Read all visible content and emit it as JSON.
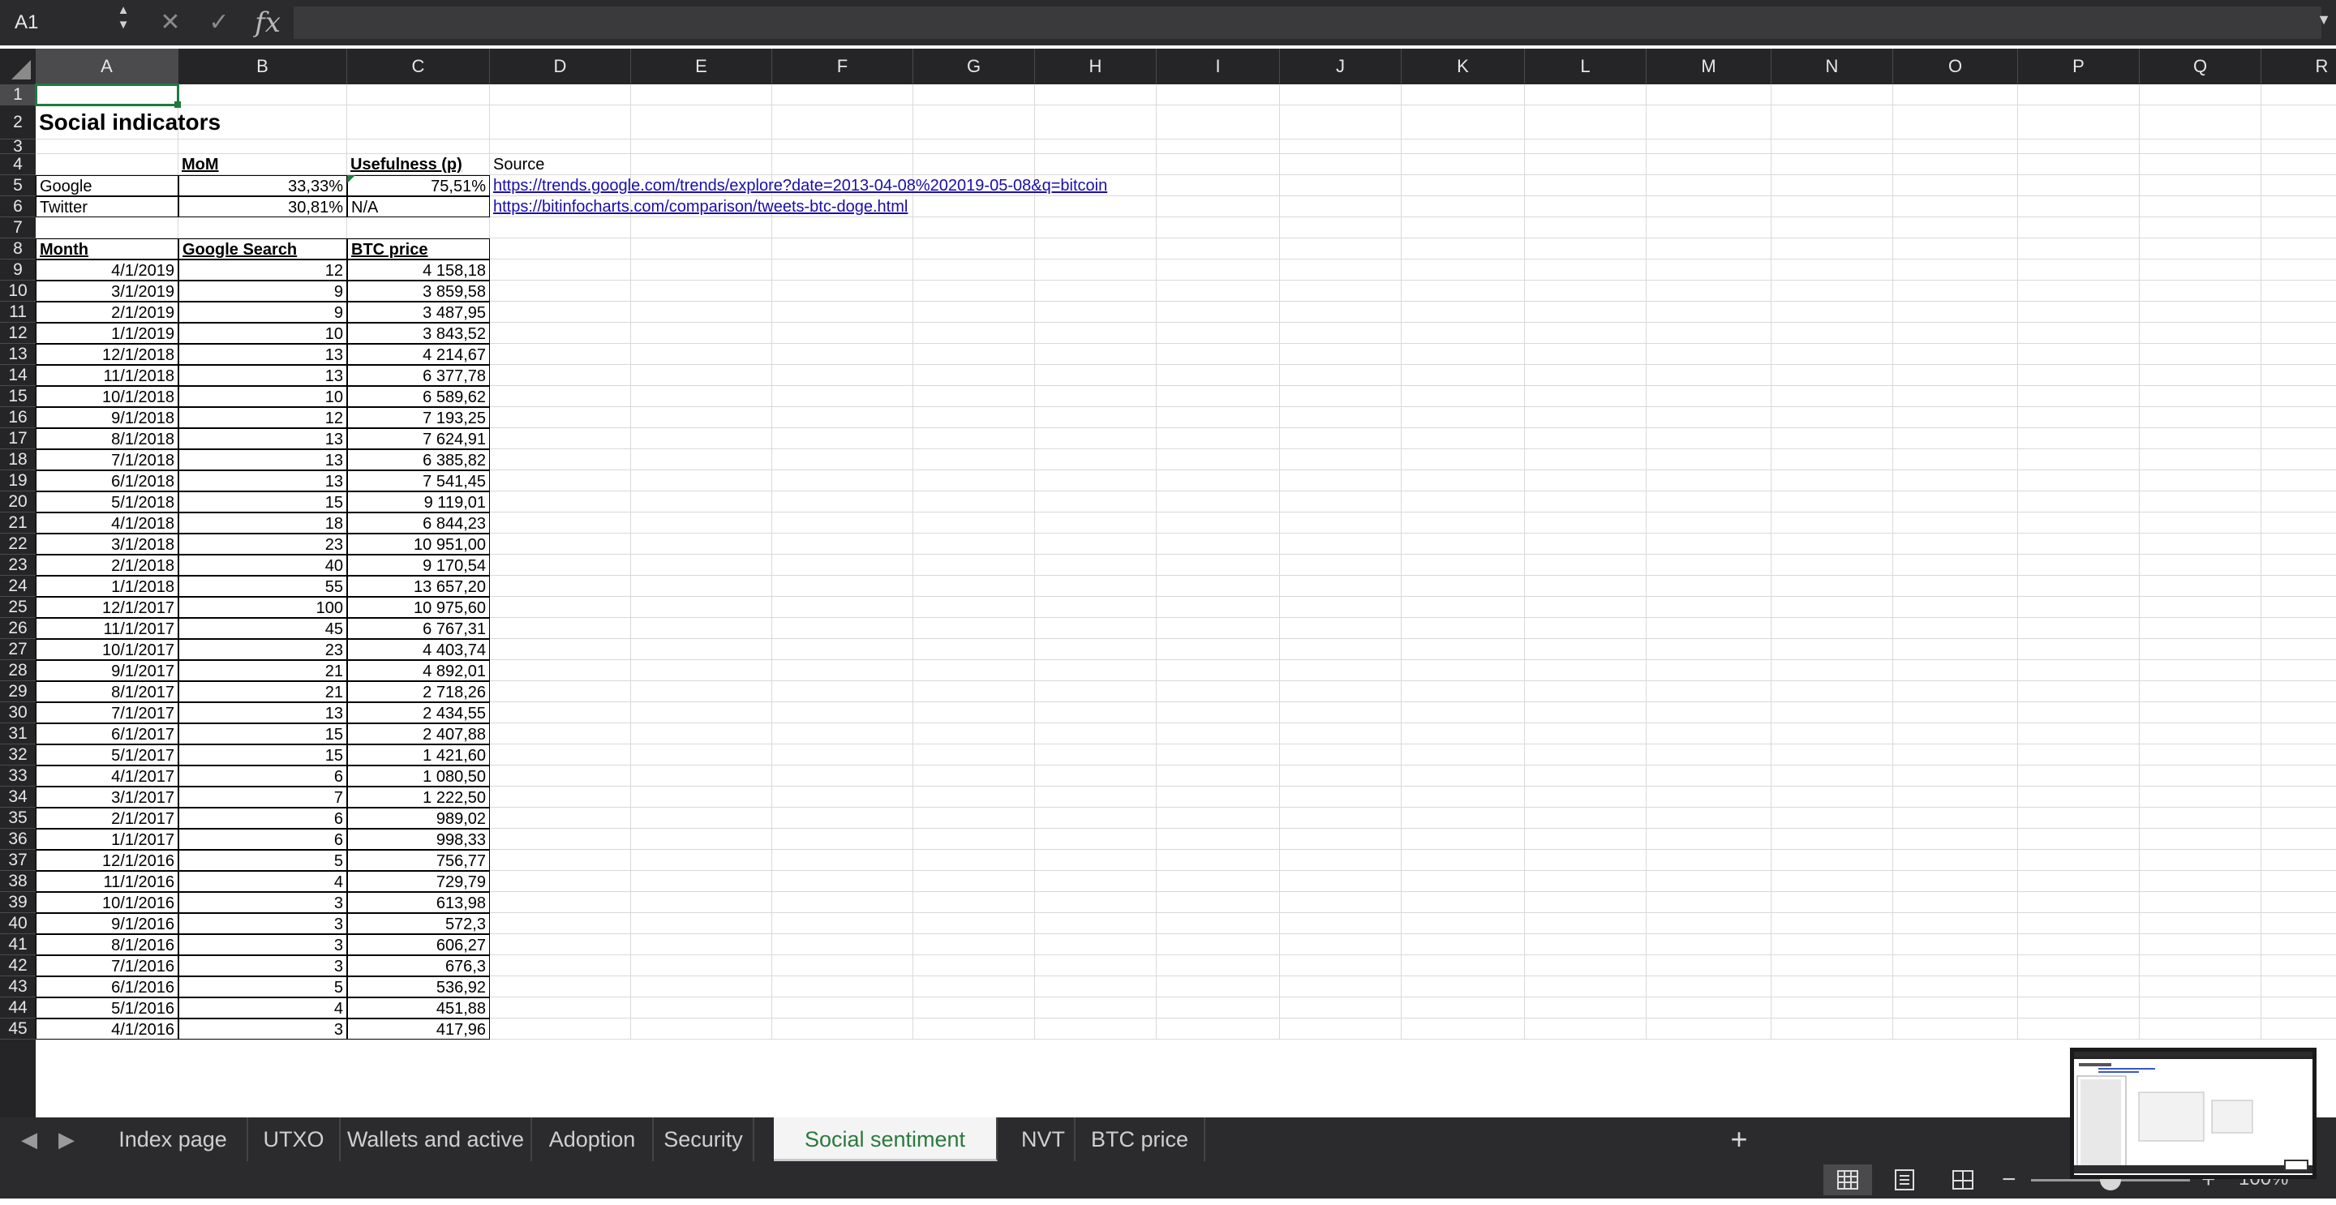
{
  "formula_bar": {
    "name_box": "A1",
    "cancel_icon": "✕",
    "enter_icon": "✓",
    "fx_label": "fx",
    "formula": ""
  },
  "columns": [
    "A",
    "B",
    "C",
    "D",
    "E",
    "F",
    "G",
    "H",
    "I",
    "J",
    "K",
    "L",
    "M",
    "N",
    "O",
    "P",
    "Q",
    "R"
  ],
  "rows": [
    "1",
    "2",
    "3",
    "4",
    "5",
    "6",
    "7",
    "8",
    "9",
    "10",
    "11",
    "12",
    "13",
    "14",
    "15",
    "16",
    "17",
    "18",
    "19",
    "20",
    "21",
    "22",
    "23",
    "24",
    "25",
    "26",
    "27",
    "28",
    "29",
    "30",
    "31",
    "32",
    "33",
    "34",
    "35",
    "36",
    "37",
    "38",
    "39",
    "40",
    "41",
    "42",
    "43",
    "44",
    "45"
  ],
  "sheet": {
    "title": "Social indicators",
    "summary_headers": {
      "mom": "MoM",
      "usefulness": "Usefulness (p)",
      "source": "Source"
    },
    "summary_rows": [
      {
        "name": "Google",
        "mom": "33,33%",
        "usefulness": "75,51%",
        "source": "https://trends.google.com/trends/explore?date=2013-04-08%202019-05-08&q=bitcoin"
      },
      {
        "name": "Twitter",
        "mom": "30,81%",
        "usefulness": "N/A",
        "source": "https://bitinfocharts.com/comparison/tweets-btc-doge.html"
      }
    ],
    "table_headers": {
      "month": "Month",
      "google_search": "Google Search",
      "btc_price": "BTC price"
    },
    "table_rows": [
      [
        "4/1/2019",
        "12",
        "4 158,18"
      ],
      [
        "3/1/2019",
        "9",
        "3 859,58"
      ],
      [
        "2/1/2019",
        "9",
        "3 487,95"
      ],
      [
        "1/1/2019",
        "10",
        "3 843,52"
      ],
      [
        "12/1/2018",
        "13",
        "4 214,67"
      ],
      [
        "11/1/2018",
        "13",
        "6 377,78"
      ],
      [
        "10/1/2018",
        "10",
        "6 589,62"
      ],
      [
        "9/1/2018",
        "12",
        "7 193,25"
      ],
      [
        "8/1/2018",
        "13",
        "7 624,91"
      ],
      [
        "7/1/2018",
        "13",
        "6 385,82"
      ],
      [
        "6/1/2018",
        "13",
        "7 541,45"
      ],
      [
        "5/1/2018",
        "15",
        "9 119,01"
      ],
      [
        "4/1/2018",
        "18",
        "6 844,23"
      ],
      [
        "3/1/2018",
        "23",
        "10 951,00"
      ],
      [
        "2/1/2018",
        "40",
        "9 170,54"
      ],
      [
        "1/1/2018",
        "55",
        "13 657,20"
      ],
      [
        "12/1/2017",
        "100",
        "10 975,60"
      ],
      [
        "11/1/2017",
        "45",
        "6 767,31"
      ],
      [
        "10/1/2017",
        "23",
        "4 403,74"
      ],
      [
        "9/1/2017",
        "21",
        "4 892,01"
      ],
      [
        "8/1/2017",
        "21",
        "2 718,26"
      ],
      [
        "7/1/2017",
        "13",
        "2 434,55"
      ],
      [
        "6/1/2017",
        "15",
        "2 407,88"
      ],
      [
        "5/1/2017",
        "15",
        "1 421,60"
      ],
      [
        "4/1/2017",
        "6",
        "1 080,50"
      ],
      [
        "3/1/2017",
        "7",
        "1 222,50"
      ],
      [
        "2/1/2017",
        "6",
        "989,02"
      ],
      [
        "1/1/2017",
        "6",
        "998,33"
      ],
      [
        "12/1/2016",
        "5",
        "756,77"
      ],
      [
        "11/1/2016",
        "4",
        "729,79"
      ],
      [
        "10/1/2016",
        "3",
        "613,98"
      ],
      [
        "9/1/2016",
        "3",
        "572,3"
      ],
      [
        "8/1/2016",
        "3",
        "606,27"
      ],
      [
        "7/1/2016",
        "3",
        "676,3"
      ],
      [
        "6/1/2016",
        "5",
        "536,92"
      ],
      [
        "5/1/2016",
        "4",
        "451,88"
      ],
      [
        "4/1/2016",
        "3",
        "417,96"
      ]
    ]
  },
  "tabs": [
    {
      "label": "Index page"
    },
    {
      "label": "UTXO"
    },
    {
      "label": "Wallets and active addresses"
    },
    {
      "label": "Adoption metrics"
    },
    {
      "label": "Security metrics"
    },
    {
      "label": "Social sentiment analysis",
      "active": true
    },
    {
      "label": "NVT"
    },
    {
      "label": "BTC price"
    }
  ],
  "add_tab_label": "+",
  "status": {
    "zoom_minus": "−",
    "zoom_plus": "+",
    "zoom_level": "100%",
    "zoom_fraction": 0.5
  },
  "colors": {
    "accent": "#1e7a3e",
    "link": "#1a0dab",
    "chrome": "#2b2b2d"
  },
  "icons": [
    "name-box-stepper-icon",
    "cancel-icon",
    "enter-icon",
    "function-icon",
    "formula-dropdown-icon",
    "select-all-corner-icon",
    "scroll-tabs-left-icon",
    "scroll-tabs-right-icon",
    "add-sheet-icon",
    "normal-view-icon",
    "page-layout-view-icon",
    "page-break-view-icon"
  ]
}
